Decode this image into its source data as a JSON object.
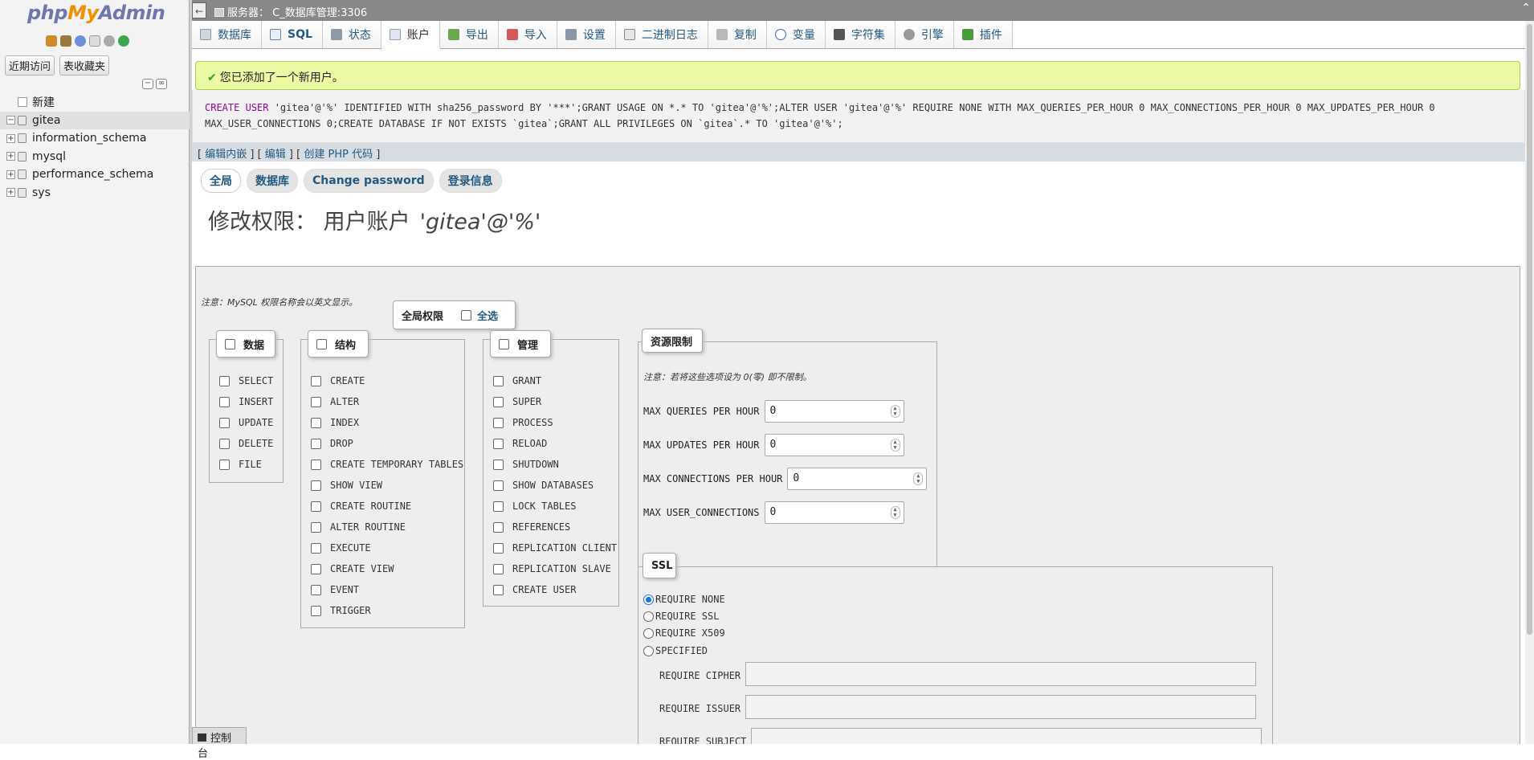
{
  "nav": {
    "logo": {
      "php": "php",
      "my": "My",
      "admin": "Admin"
    },
    "recent_label": "近期访问",
    "favorites_label": "表收藏夹",
    "icons": [
      "home-icon",
      "logout-icon",
      "help-icon",
      "docs-icon",
      "settings-icon",
      "reload-icon"
    ],
    "new_label": "新建",
    "databases": [
      "gitea",
      "information_schema",
      "mysql",
      "performance_schema",
      "sys"
    ],
    "selected_db": "gitea"
  },
  "topbar": {
    "server": "服务器： C_数据库管理:3306"
  },
  "tabs": [
    {
      "label": "数据库",
      "icon": "database-icon"
    },
    {
      "label": "SQL",
      "icon": "sql-icon"
    },
    {
      "label": "状态",
      "icon": "status-icon"
    },
    {
      "label": "账户",
      "icon": "accounts-icon",
      "active": true
    },
    {
      "label": "导出",
      "icon": "export-icon"
    },
    {
      "label": "导入",
      "icon": "import-icon"
    },
    {
      "label": "设置",
      "icon": "wrench-icon"
    },
    {
      "label": "二进制日志",
      "icon": "binlog-icon"
    },
    {
      "label": "复制",
      "icon": "replication-icon"
    },
    {
      "label": "变量",
      "icon": "variables-icon"
    },
    {
      "label": "字符集",
      "icon": "charset-icon"
    },
    {
      "label": "引擎",
      "icon": "engine-icon"
    },
    {
      "label": "插件",
      "icon": "plugin-icon"
    }
  ],
  "message": {
    "success": "您已添加了一个新用户。"
  },
  "sql": {
    "line1_kw": "CREATE USER",
    "line1_rest": " 'gitea'@'%' IDENTIFIED WITH sha256_password BY '***';GRANT USAGE ON *.* TO 'gitea'@'%';ALTER USER 'gitea'@'%' REQUIRE NONE WITH MAX_QUERIES_PER_HOUR 0 MAX_CONNECTIONS_PER_HOUR 0 MAX_UPDATES_PER_HOUR 0",
    "line2": "MAX_USER_CONNECTIONS 0;CREATE DATABASE IF NOT EXISTS `gitea`;GRANT ALL PRIVILEGES ON `gitea`.* TO 'gitea'@'%';",
    "links": {
      "edit_inline": "编辑内嵌",
      "edit": "编辑",
      "create_php": "创建 PHP 代码"
    }
  },
  "subtabs": [
    "全局",
    "数据库",
    "Change password",
    "登录信息"
  ],
  "heading": {
    "title": "修改权限：  用户账户",
    "user": "'gitea'@'%'"
  },
  "global": {
    "legend": "全局权限",
    "select_all": "全选",
    "note": "注意：MySQL 权限名称会以英文显示。",
    "groups": [
      {
        "legend": "数据",
        "items": [
          "SELECT",
          "INSERT",
          "UPDATE",
          "DELETE",
          "FILE"
        ]
      },
      {
        "legend": "结构",
        "items": [
          "CREATE",
          "ALTER",
          "INDEX",
          "DROP",
          "CREATE TEMPORARY TABLES",
          "SHOW VIEW",
          "CREATE ROUTINE",
          "ALTER ROUTINE",
          "EXECUTE",
          "CREATE VIEW",
          "EVENT",
          "TRIGGER"
        ]
      },
      {
        "legend": "管理",
        "items": [
          "GRANT",
          "SUPER",
          "PROCESS",
          "RELOAD",
          "SHUTDOWN",
          "SHOW DATABASES",
          "LOCK TABLES",
          "REFERENCES",
          "REPLICATION CLIENT",
          "REPLICATION SLAVE",
          "CREATE USER"
        ]
      }
    ],
    "resources": {
      "legend": "资源限制",
      "note": "注意：若将这些选项设为 0(零) 即不限制。",
      "rows": [
        {
          "label": "MAX QUERIES PER HOUR",
          "value": "0"
        },
        {
          "label": "MAX UPDATES PER HOUR",
          "value": "0"
        },
        {
          "label": "MAX CONNECTIONS PER HOUR",
          "value": "0"
        },
        {
          "label": "MAX USER_CONNECTIONS",
          "value": "0"
        }
      ]
    },
    "ssl": {
      "legend": "SSL",
      "options": [
        "REQUIRE NONE",
        "REQUIRE SSL",
        "REQUIRE X509",
        "SPECIFIED"
      ],
      "selected": "REQUIRE NONE",
      "fields": [
        "REQUIRE CIPHER",
        "REQUIRE ISSUER",
        "REQUIRE SUBJECT"
      ]
    }
  },
  "console": {
    "label": "控制台"
  }
}
